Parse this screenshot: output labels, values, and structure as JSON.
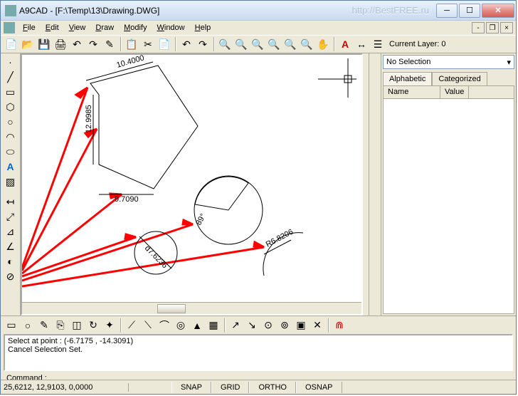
{
  "title": "A9CAD - [F:\\Temp\\13\\Drawing.DWG]",
  "link": "http://BestFREE.ru",
  "menu": {
    "file": "File",
    "edit": "Edit",
    "view": "View",
    "draw": "Draw",
    "modify": "Modify",
    "window": "Window",
    "help": "Help"
  },
  "layer_label": "Current Layer: 0",
  "right": {
    "selection": "No Selection",
    "tab1": "Alphabetic",
    "tab2": "Categorized",
    "col1": "Name",
    "col2": "Value"
  },
  "cmd": {
    "line1": "Select at point : (-6.7175 , -14.3091)",
    "line2": "Cancel Selection Set.",
    "prompt": "Command :"
  },
  "status": {
    "coord": "25,6212, 12,9103, 0,0000",
    "snap": "SNAP",
    "grid": "GRID",
    "ortho": "ORTHO",
    "osnap": "OSNAP"
  },
  "dims": {
    "d1": "10.4000",
    "d2": "12.9985",
    "d3": "9.7090",
    "d4": "d7.6236",
    "d5": "89°",
    "d6": "R6.8206"
  }
}
